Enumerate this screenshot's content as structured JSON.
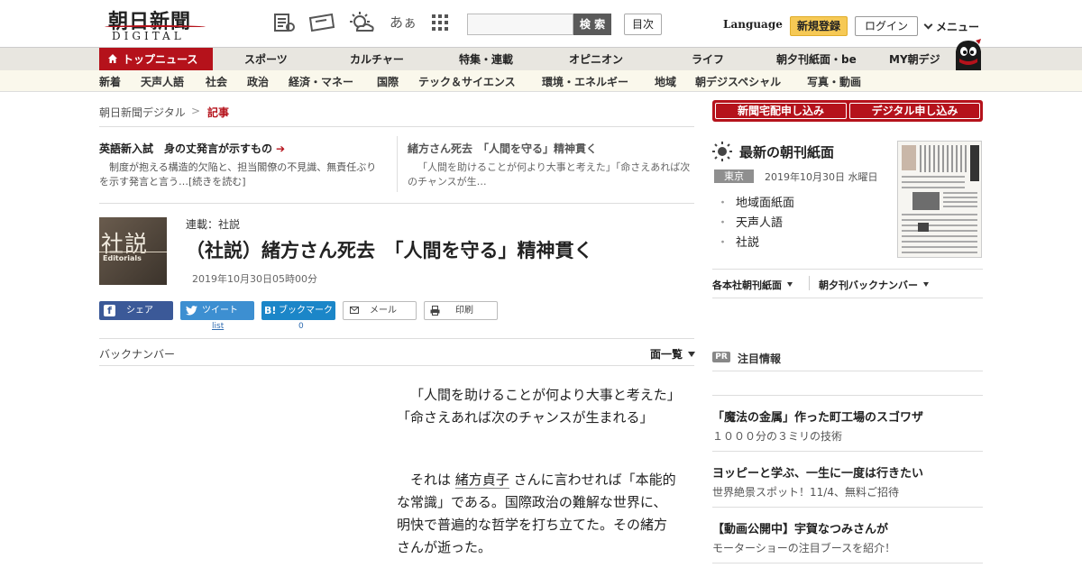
{
  "header": {
    "logo_jp": "朝日新聞",
    "logo_en": "DIGITAL",
    "font_toggle": "あぁ",
    "search_placeholder": "",
    "search_button": "検 索",
    "toc_button": "目次",
    "language": "Language",
    "register": "新規登録",
    "login": "ログイン",
    "menu": "メニュー"
  },
  "nav_main": [
    "トップニュース",
    "スポーツ",
    "カルチャー",
    "特集・連載",
    "オピニオン",
    "ライフ",
    "朝夕刊紙面・be",
    "MY朝デジ"
  ],
  "nav_sub": [
    "新着",
    "天声人語",
    "社会",
    "政治",
    "経済・マネー",
    "国際",
    "テック＆サイエンス",
    "環境・エネルギー",
    "地域",
    "朝デジスペシャル",
    "写真・動画"
  ],
  "breadcrumb": {
    "home": "朝日新聞デジタル",
    "sep": ">",
    "current": "記事"
  },
  "related": [
    {
      "title": "英語新入試　身の丈発言が示すもの",
      "desc": "制度が抱える構造的欠陥と、担当閣僚の不見識、無責任ぶりを示す発言と言う…[続きを読む]"
    },
    {
      "title": "緒方さん死去　「人間を守る」精神貫く",
      "desc": "「人間を助けることが何より大事と考えた」「命さえあれば次のチャンスが生…"
    }
  ],
  "article": {
    "image_text": "社説",
    "image_sub": "Editorials",
    "series": "連載：社説",
    "title": "（社説）緒方さん死去　「人間を守る」精神貫く",
    "date": "2019年10月30日05時00分",
    "share": {
      "facebook": "シェア",
      "twitter": "ツイート",
      "hatena_logo": "B!",
      "hatena": "ブックマーク",
      "mail": "メール",
      "print": "印刷",
      "tweet_count": "list",
      "bookmark_count": "0"
    },
    "backnumber": "バックナンバー",
    "list_all": "面一覧",
    "p1": "「人間を助けることが何より大事と考えた」「命さえあれば次のチャンスが生まれる」",
    "p2_pre": "それは",
    "p2_name": "緒方貞子",
    "p2_post": "さんに言わせれば「本能的な常識」である。国際政治の難解な世界に、明快で普遍的な哲学を打ち立てた。その緒方さんが逝った。"
  },
  "sidebar": {
    "subscribe_paper": "新聞宅配申し込み",
    "subscribe_digital": "デジタル申し込み",
    "choukan_title": "最新の朝刊紙面",
    "edition": "東京",
    "choukan_date": "2019年10月30日 水曜日",
    "links": [
      "地域面紙面",
      "天声人語",
      "社説"
    ],
    "dropdown1": "各本社朝刊紙面",
    "dropdown2": "朝夕刊バックナンバー",
    "pr_badge": "PR",
    "pr_title": "注目情報",
    "promos": [
      {
        "headline": "「魔法の金属」作った町工場のスゴワザ",
        "sub": "１０００分の３ミリの技術"
      },
      {
        "headline": "ヨッピーと学ぶ、一生に一度は行きたい",
        "sub": "世界絶景スポット！11/4、無料ご招待"
      },
      {
        "headline": "【動画公開中】宇賀なつみさんが",
        "sub": "モーターショーの注目ブースを紹介！"
      }
    ]
  },
  "colors": {
    "brand_red": "#b5121b",
    "register_yellow": "#f6c955",
    "facebook": "#3b5998",
    "twitter": "#3d8fd1",
    "hatena": "#1b86c8"
  }
}
